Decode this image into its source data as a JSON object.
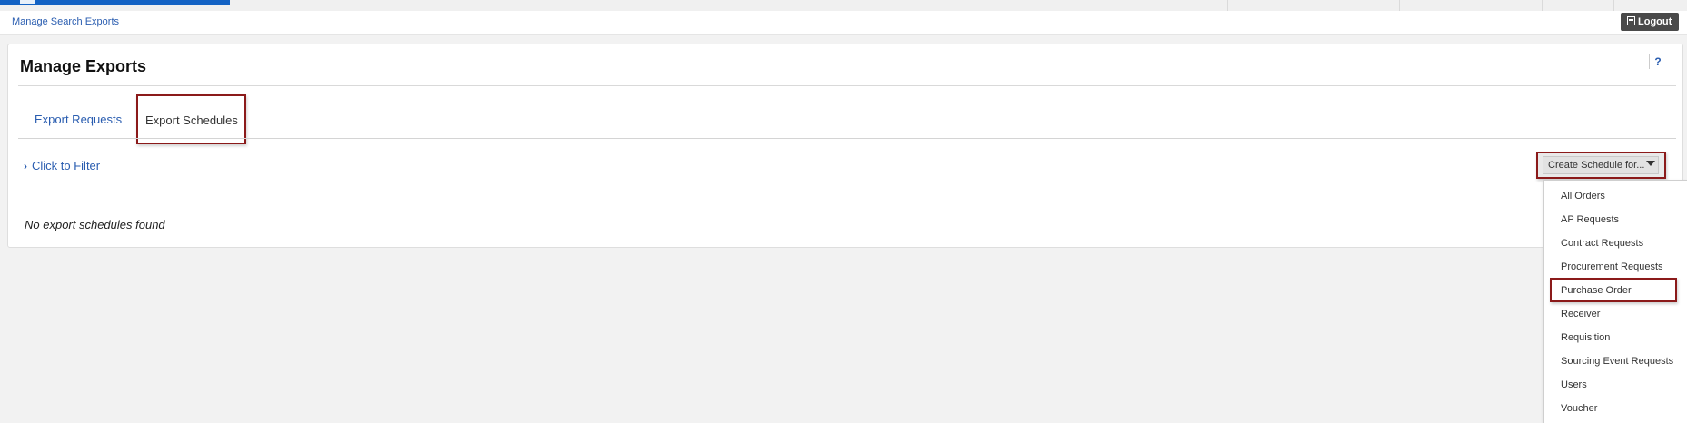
{
  "breadcrumb": "Manage Search Exports",
  "logout_label": "Logout",
  "page": {
    "title": "Manage Exports",
    "help_label": "?"
  },
  "tabs": [
    {
      "label": "Export Requests"
    },
    {
      "label": "Export Schedules"
    }
  ],
  "filter_label": "Click to Filter",
  "empty_message": "No export schedules found",
  "create_schedule": {
    "label": "Create Schedule for...",
    "options": [
      "All Orders",
      "AP Requests",
      "Contract Requests",
      "Procurement Requests",
      "Purchase Order",
      "Receiver",
      "Requisition",
      "Sourcing Event Requests",
      "Users",
      "Voucher"
    ]
  },
  "colors": {
    "link": "#2a5db0",
    "highlight_border": "#8b1a1a",
    "brand": "#1463c4"
  }
}
